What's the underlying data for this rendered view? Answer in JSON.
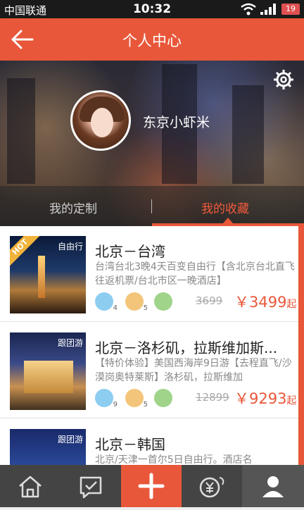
{
  "status_bar": {
    "carrier": "中国联通",
    "time": "10:32",
    "battery": "19"
  },
  "header": {
    "title": "个人中心"
  },
  "profile": {
    "username": "东京小虾米"
  },
  "tabs": [
    {
      "label": "我的定制"
    },
    {
      "label": "我的收藏"
    }
  ],
  "active_tab": "我的收藏",
  "favorites": [
    {
      "tag": "自由行",
      "badge": "HOT",
      "title": "北京－台湾",
      "desc": "台湾台北3晚4天百变自由行【含北京台北直飞往返机票/台北市区一晚酒店】",
      "nights": "4",
      "hotel": "5",
      "old_price": "3699",
      "price": "￥3499",
      "price_suffix": "起"
    },
    {
      "tag": "跟团游",
      "title": "北京－洛杉矶，拉斯维加斯...",
      "desc": "【特价体验】美国西海岸9日游【去程直飞/沙漠岗奥特莱斯】洛杉矶，拉斯维加",
      "nights": "9",
      "hotel": "5",
      "old_price": "12899",
      "price": "￥9293",
      "price_suffix": "起"
    },
    {
      "tag": "跟团游",
      "title": "北京－韩国",
      "desc": "北京/天津一首尔5日自由行。酒店名"
    }
  ],
  "colors": {
    "accent": "#e8573a",
    "tabbar": "#444444"
  },
  "tabbar_icons": [
    "home-icon",
    "message-icon",
    "plus-icon",
    "finance-icon",
    "user-icon"
  ]
}
